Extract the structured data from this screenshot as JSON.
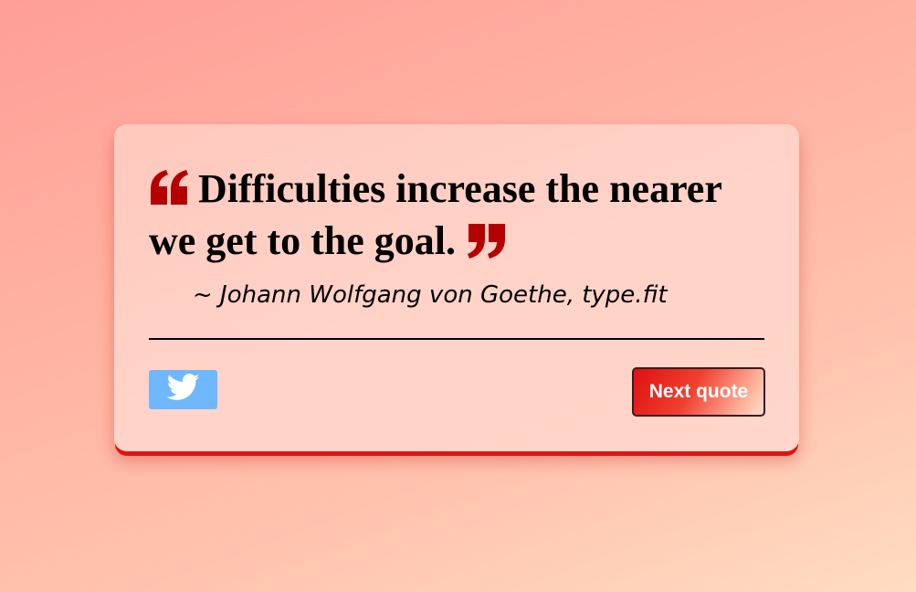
{
  "quote": {
    "text": "Difficulties increase the nearer we get to the goal.",
    "author_line": "~ Johann Wolfgang von Goethe, type.fit"
  },
  "actions": {
    "next_label": "Next quote"
  },
  "icons": {
    "open_quote": "open-quote-icon",
    "close_quote": "close-quote-icon",
    "tweet": "twitter-bird-icon"
  },
  "colors": {
    "quote_mark": "#b30000",
    "tweet_button": "#6fb8ff",
    "card_shadow": "#e01414"
  }
}
